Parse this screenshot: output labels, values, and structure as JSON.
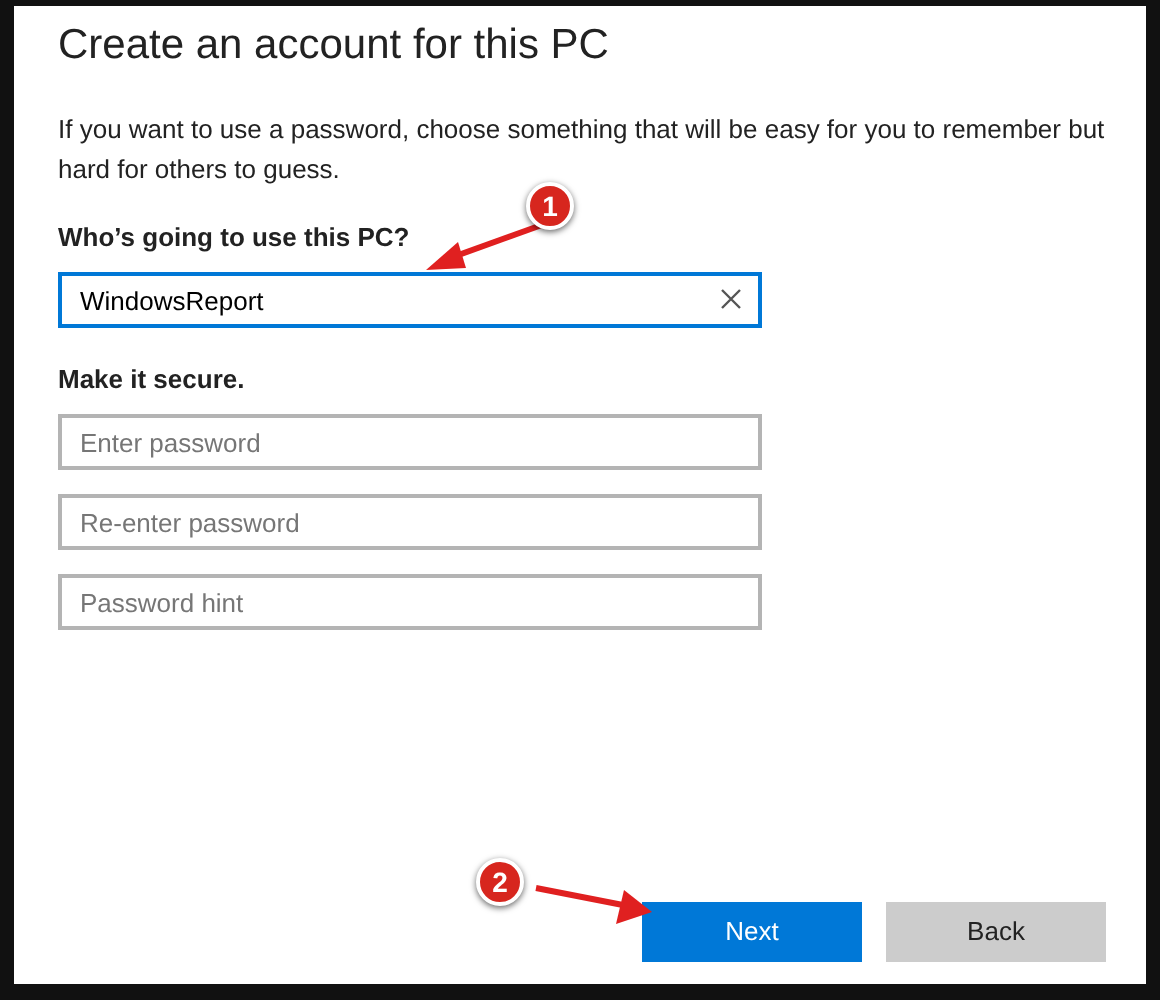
{
  "title": "Create an account for this PC",
  "intro": "If you want to use a password, choose something that will be easy for you to remember but hard for others to guess.",
  "sections": [
    {
      "heading": "Who’s going to use this PC?",
      "fields": [
        {
          "value": "WindowsReport",
          "focused": true,
          "clearable": true
        }
      ]
    },
    {
      "heading": "Make it secure.",
      "fields": [
        {
          "placeholder": "Enter password",
          "focused": false,
          "clearable": false
        },
        {
          "placeholder": "Re-enter password",
          "focused": false,
          "clearable": false
        },
        {
          "placeholder": "Password hint",
          "focused": false,
          "clearable": false
        }
      ]
    }
  ],
  "buttons": [
    {
      "label": "Next",
      "kind": "primary"
    },
    {
      "label": "Back",
      "kind": "secondary"
    }
  ],
  "callouts": [
    {
      "number": "1"
    },
    {
      "number": "2"
    }
  ]
}
